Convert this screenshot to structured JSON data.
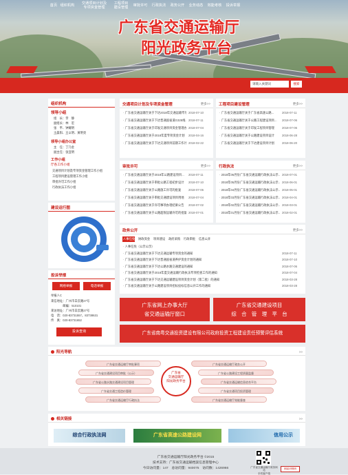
{
  "hero": {
    "title_line1": "广东省交通运输厅",
    "title_line2": "阳光政务平台"
  },
  "nav": {
    "items": [
      {
        "line1": "首页",
        "line2": ""
      },
      {
        "line1": "组织机构",
        "line2": ""
      },
      {
        "line1": "交通项目计划及",
        "line2": "专项资金管理"
      },
      {
        "line1": "工程项目",
        "line2": "建设管理"
      },
      {
        "line1": "审批许可",
        "line2": ""
      },
      {
        "line1": "行政执法",
        "line2": ""
      },
      {
        "line1": "政务公开",
        "line2": ""
      },
      {
        "line1": "业务动态",
        "line2": ""
      },
      {
        "line1": "效能考核",
        "line2": ""
      },
      {
        "line1": "投诉举报",
        "line2": ""
      }
    ],
    "search_placeholder": "请输入关键词",
    "search_button": "搜索"
  },
  "left": {
    "org_title": "组织机构",
    "leaders_title": "领导小组",
    "leaders": [
      {
        "role": "组　长：",
        "names": "李　静"
      },
      {
        "role": "副组长：",
        "names": "林　宏"
      },
      {
        "role": "",
        "names": "张　平、钟耀明"
      },
      {
        "role": "",
        "names": "王晨阳、王以明、黄明亮"
      }
    ],
    "office_title": "领导小组办公室",
    "office": [
      {
        "role": "主　任：",
        "names": "丁乃金"
      },
      {
        "role": "副主任：",
        "names": "张亚明"
      }
    ],
    "group_title": "工作小组",
    "groups_heading": "厅各工作小组",
    "groups": [
      "交通项目计划及专项资金管理工作小组",
      "工程项目建设管理工作小组",
      "审批许可工作小组",
      "行政执法工作小组"
    ],
    "chart_title": "建设运行图",
    "complaint_title": "投诉举报",
    "complaint_btn1": "网络举报",
    "complaint_btn2": "电话举报",
    "contact_lines": [
      "举报人C",
      "来信地址：广州市白云路27号",
      "　　　　邮编：510101",
      "来访地址：广州市白云路27号",
      "电　话：020-83731557，83738631",
      "传　真：020-83731652"
    ],
    "query_btn": "投诉查询"
  },
  "panels": {
    "p1": {
      "title": "交通项目计划及专项资金管理",
      "more": "更多>>",
      "rows": [
        {
          "t": "广东省交通运输厅关于下达2018年交通运输专项资金计划的通知",
          "d": "2018-07-10"
        },
        {
          "t": "广东省交通运输厅关于下达普通国省道G325线...",
          "d": "2018-07-11"
        },
        {
          "t": "广东省交通运输厅关于印发交通项目资金管理办法",
          "d": "2018-07-04"
        },
        {
          "t": "广东省交通运输厅关于2018年度专项资金计划",
          "d": "2018-04-16"
        },
        {
          "t": "广东省交通运输厅关于下达交通项目前期工作计划",
          "d": "2018-02-22"
        }
      ]
    },
    "p2": {
      "title": "工程项目建设管理",
      "more": "更多>>",
      "rows": [
        {
          "t": "广东省交通运输厅关于广东省高速公路...",
          "d": "2018-07-11"
        },
        {
          "t": "广东省交通运输厅关于公路工程建设项目...",
          "d": "2018-07-06"
        },
        {
          "t": "广东省交通运输厅关于印发工程项目管理",
          "d": "2018-07-06"
        },
        {
          "t": "广东省交通运输厅关于公路建设项目设计",
          "d": "2018-06-28"
        },
        {
          "t": "广东省交通运输厅关于下达建设项目计划",
          "d": "2018-06-20"
        }
      ]
    },
    "p3": {
      "title": "审批许可",
      "more": "更多>>",
      "rows": [
        {
          "t": "广东省交通运输厅关于2018年公路建设项目...",
          "d": "2018-07-11"
        },
        {
          "t": "广东省交通运输厅关于审批公路工程初步设计",
          "d": "2018-07-10"
        },
        {
          "t": "广东省交通运输厅关于公路施工许可的批复",
          "d": "2018-07-06"
        },
        {
          "t": "广东省交通运输厅关于审批交通建设项目用地",
          "d": "2018-07-04"
        },
        {
          "t": "广东省交通运输厅关于许可事项办理结果公告",
          "d": "2018-07-02"
        },
        {
          "t": "广东省交通运输厅关于公路超限运输许可的批复",
          "d": "2018-07-01"
        }
      ]
    },
    "p4": {
      "title": "行政执法",
      "more": "更多>>",
      "rows": [
        {
          "t": "2018年06月份广东省交通运输行政执法公示...",
          "d": "2018-07-01"
        },
        {
          "t": "2018年05月份广东省交通运输行政执法公示...",
          "d": "2018-06-01"
        },
        {
          "t": "2018年04月份广东省交通运输行政执法公示...",
          "d": "2018-05-01"
        },
        {
          "t": "2018年03月份广东省交通运输行政执法公示...",
          "d": "2018-04-01"
        },
        {
          "t": "2018年02月份广东省交通运输行政执法公示...",
          "d": "2018-03-01"
        },
        {
          "t": "2018年01月份广东省交通运输行政执法公示...",
          "d": "2018-02-01"
        }
      ]
    },
    "p5": {
      "title": "政务公开",
      "more": "更多>>",
      "tabs": [
        "人事任免",
        "财政资金",
        "项目建设",
        "政府采购",
        "行政审批",
        "信息公开"
      ],
      "rows": [
        {
          "t": "人事任免（公示公示）",
          "d": ""
        },
        {
          "t": "广东省交通运输厅关于下达交通运输专项资金的通知",
          "d": "2018-07-11"
        },
        {
          "t": "广东省交通运输厅关于下达普通国省道养护资金计划的通知",
          "d": "2018-07-10"
        },
        {
          "t": "广东省交通运输厅关于下达公路水路交通建设的通知",
          "d": "2018-07-06"
        },
        {
          "t": "广东省交通运输厅关于2018年度交通运输行政执法专项检查工作的通知",
          "d": "2018-07-04"
        },
        {
          "t": "广东省交通运输厅关于下达交通运输建设项目资金计划（第二批）的通知",
          "d": "2018-03-28"
        },
        {
          "t": "广东省交通运输厅关于公路建设项目招标投标信息公开工作的通知",
          "d": "2018-03-28"
        }
      ]
    }
  },
  "redbars": {
    "b1": "广东省网上办事大厅\n省交通运输厅窗口",
    "b2": "广东省交通建设项目\n综　合　管　理　平　台",
    "b3": "广东省南粤交通投资建设有限公司政府投资工程建设责任预警评估系统"
  },
  "flow": {
    "title": "阳光导航",
    "center": "广东省\n交通运输厅\n阳光政务平台",
    "left_pills": [
      "广东省交通运输厅审批事项",
      "广东省交通建设项目审批（公示）",
      "广东省公路水路交通建设项目管理",
      "广东省交通工程造价管理",
      "广东省交通运输厅行政执法"
    ],
    "right_pills": [
      "广东省交通运输厅政务公开",
      "广东省公路建设工程质量监督",
      "广东省交通运输信息综合平台",
      "广东省交通项目投资管理",
      "广东省交通运输厅效能督查"
    ]
  },
  "links": {
    "title": "相关链接",
    "banner1": "综合行政执法网",
    "banner2": "广东省高速公路建设网",
    "banner3": "信用公示"
  },
  "footer": {
    "line1": "广东省交通运输厅阳光政务平台 ©2015",
    "line2": "技术支持：广东省交通运输档案信息管理中心",
    "line3": "今日访问量：147　总访问量：940075　访问数：1426966",
    "qr_caption": "广东省交通运输厅政务网站\n手机客户端",
    "badge_text": "网站识别码"
  },
  "colors": {
    "brand": "#d7281f",
    "text": "#333333",
    "bg": "#eef0f2"
  }
}
